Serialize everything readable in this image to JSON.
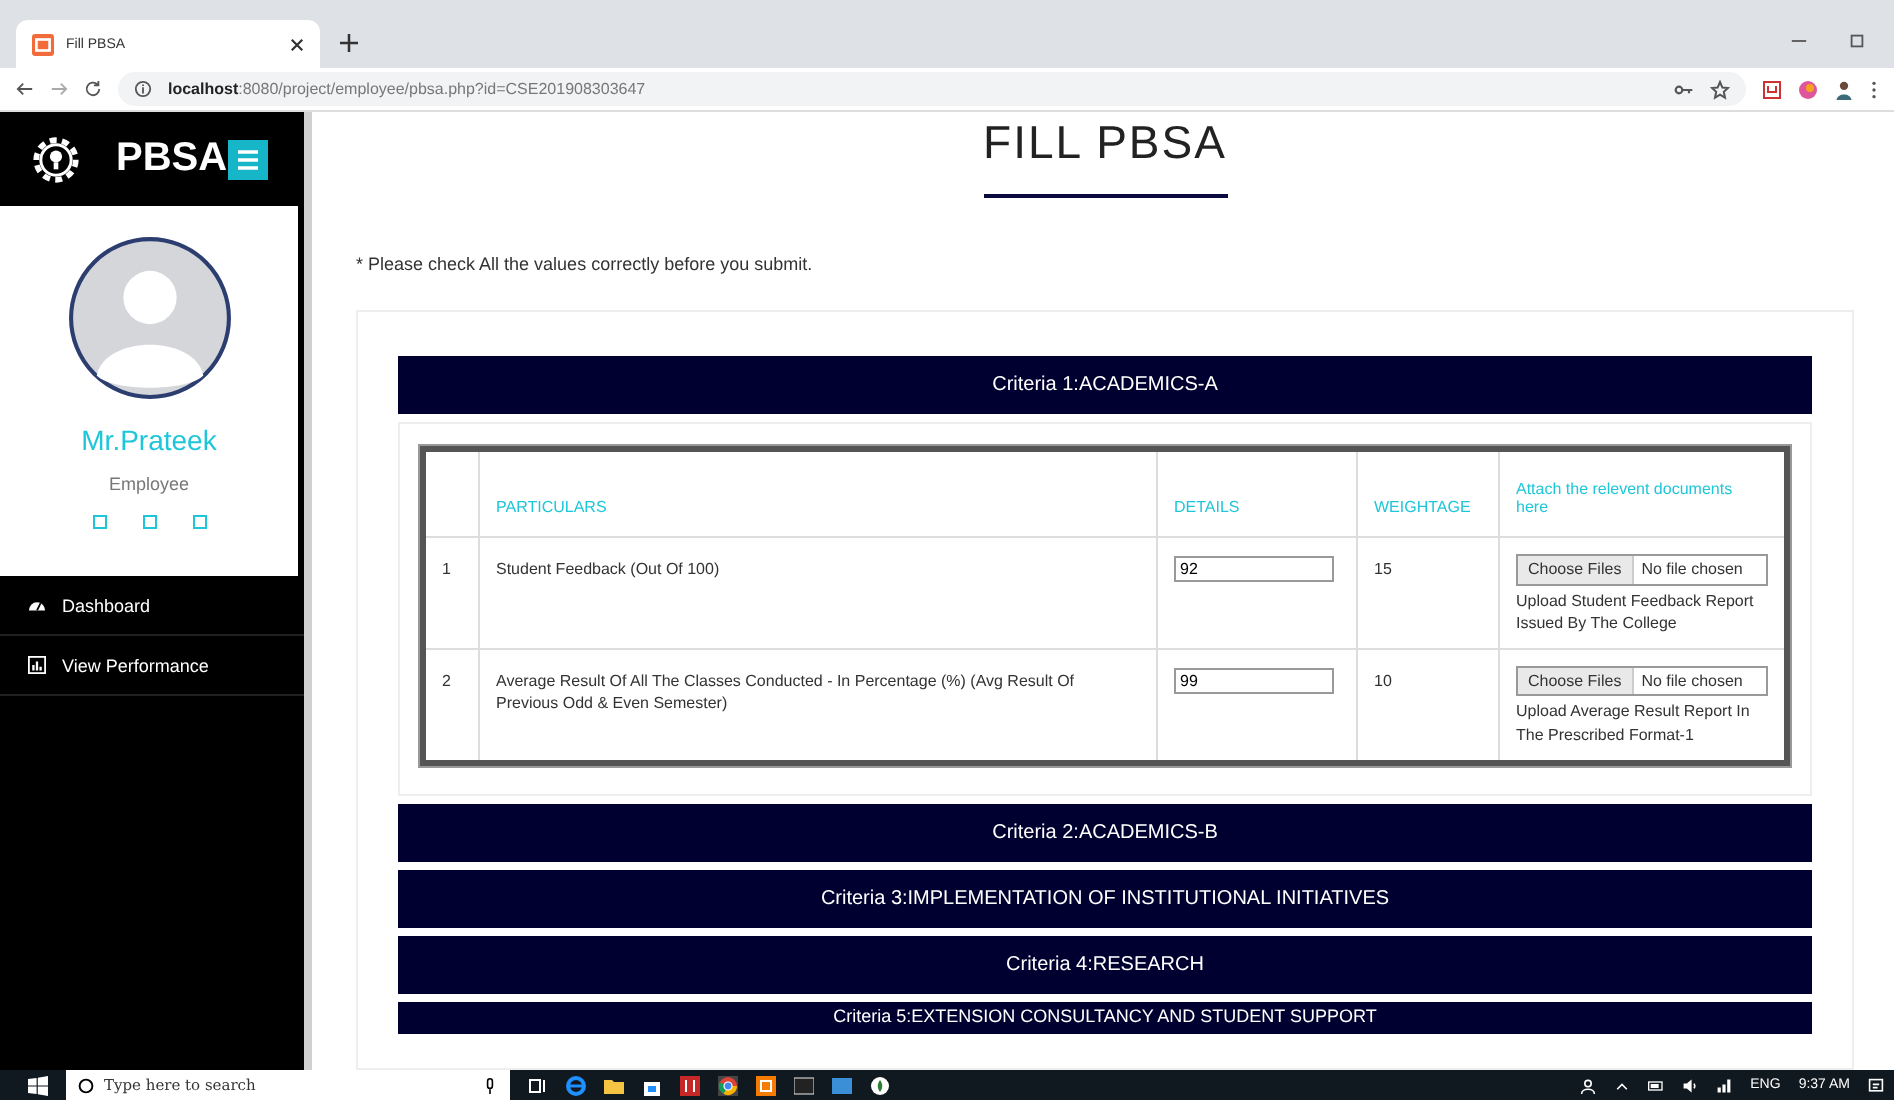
{
  "browser": {
    "tab_title": "Fill PBSA",
    "url_host": "localhost",
    "url_rest": ":8080/project/employee/pbsa.php?id=CSE201908303647"
  },
  "sidebar": {
    "brand": "PBSA",
    "user_name": "Mr.Prateek",
    "role": "Employee",
    "menu": [
      {
        "label": "Dashboard",
        "kind": "dashboard",
        "selected": false
      },
      {
        "label": "View Performance",
        "kind": "chart",
        "selected": false
      }
    ]
  },
  "main": {
    "title": "FILL PBSA",
    "note": "* Please check All the values correctly before you submit.",
    "criteria": [
      {
        "title": "Criteria 1:ACADEMICS-A",
        "table": {
          "columns": [
            "",
            "PARTICULARS",
            "DETAILS",
            "WEIGHTAGE",
            "Attach the relevent documents here"
          ],
          "rows": [
            {
              "no": "1",
              "particular": "Student Feedback (Out Of 100)",
              "details": "92",
              "weightage": "15",
              "file_button": "Choose Files",
              "file_status": "No file chosen",
              "hint": "Upload Student Feedback Report Issued By The College"
            },
            {
              "no": "2",
              "particular": "Average Result Of All The Classes Conducted - In Percentage (%) (Avg Result Of Previous Odd & Even Semester)",
              "details": "99",
              "weightage": "10",
              "file_button": "Choose Files",
              "file_status": "No file chosen",
              "hint": "Upload Average Result Report In The Prescribed Format-1"
            }
          ]
        }
      },
      {
        "title": "Criteria 2:ACADEMICS-B"
      },
      {
        "title": "Criteria 3:IMPLEMENTATION OF INSTITUTIONAL INITIATIVES"
      },
      {
        "title": "Criteria 4:RESEARCH"
      },
      {
        "title": "Criteria 5:EXTENSION CONSULTANCY AND STUDENT SUPPORT"
      }
    ]
  },
  "taskbar": {
    "search_placeholder": "Type here to search",
    "language": "ENG",
    "time": "9:37 AM"
  }
}
